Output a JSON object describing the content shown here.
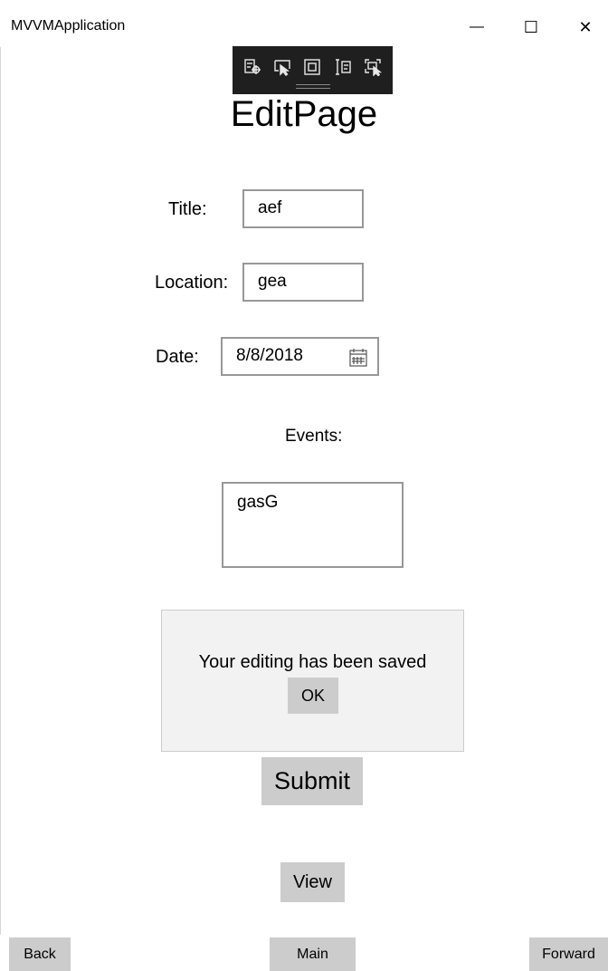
{
  "window": {
    "title": "MVVMApplication",
    "minimize_glyph": "—",
    "maximize_glyph": "☐",
    "close_glyph": "✕"
  },
  "dev_toolbar": {
    "tools": [
      "live-visual-tree-icon",
      "select-element-icon",
      "display-layout-adorners-icon",
      "track-focus-icon",
      "preview-selection-icon"
    ]
  },
  "page": {
    "heading": "EditPage"
  },
  "form": {
    "title_label": "Title:",
    "title_value": "aef",
    "location_label": "Location:",
    "location_value": "gea",
    "date_label": "Date:",
    "date_value": "8/8/2018",
    "events_label": "Events:",
    "events_value": "gasG"
  },
  "dialog": {
    "message": "Your editing has been saved",
    "ok_label": "OK"
  },
  "buttons": {
    "submit": "Submit",
    "view": "View"
  },
  "nav": {
    "back": "Back",
    "main": "Main",
    "forward": "Forward"
  }
}
